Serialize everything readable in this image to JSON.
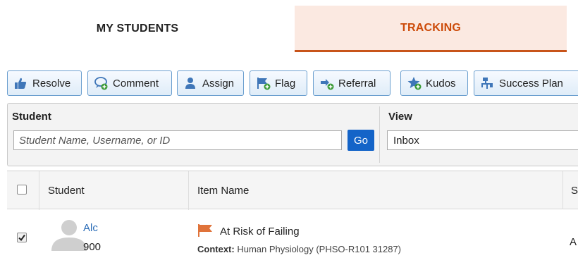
{
  "tabs": [
    {
      "label": "MY STUDENTS",
      "active": false
    },
    {
      "label": "TRACKING",
      "active": true
    }
  ],
  "toolbar": {
    "resolve": "Resolve",
    "comment": "Comment",
    "assign": "Assign",
    "flag": "Flag",
    "referral": "Referral",
    "kudos": "Kudos",
    "success_plan": "Success Plan"
  },
  "filter": {
    "student_label": "Student",
    "student_placeholder": "Student Name, Username, or ID",
    "go_label": "Go",
    "view_label": "View",
    "view_value": "Inbox"
  },
  "table": {
    "headers": {
      "student": "Student",
      "item_name": "Item Name",
      "next": "S"
    },
    "rows": [
      {
        "checked": true,
        "student_name": "Alc",
        "student_id": "900",
        "item_title": "At Risk of Failing",
        "context_label": "Context:",
        "context_value": "Human Physiology (PHSO-R101 31287)",
        "next_col": "A"
      }
    ]
  },
  "colors": {
    "accent": "#cc4a08",
    "tab_active_bg": "#fbe9e1",
    "link": "#2a6cb7",
    "go_button": "#1464c8",
    "flag": "#e0733a",
    "toolbar_icon": "#3f76b8",
    "add_badge": "#3a9a35"
  },
  "icons": [
    "thumbs-up-icon",
    "comment-add-icon",
    "user-icon",
    "flag-add-icon",
    "referral-add-icon",
    "star-add-icon",
    "success-plan-icon",
    "avatar-icon",
    "flag-icon"
  ]
}
